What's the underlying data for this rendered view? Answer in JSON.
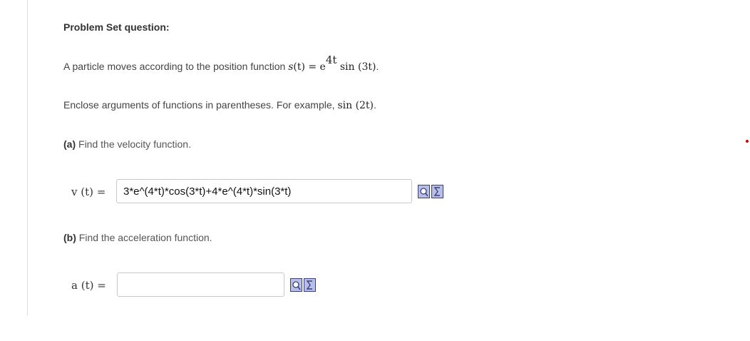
{
  "heading": "Problem Set question:",
  "problem": {
    "intro": "A particle moves according to the position function",
    "func_name": "s",
    "func_arg": "(t) = e",
    "exponent": "4t",
    "func_rest": "sin (3t)",
    "end": "."
  },
  "hint": {
    "text": "Enclose arguments of functions in parentheses. For example,",
    "example": "sin (2t)",
    "end": "."
  },
  "part_a": {
    "letter": "(a)",
    "text": "Find the velocity function.",
    "label": "v (t) =",
    "value": "3*e^(4*t)*cos(3*t)+4*e^(4*t)*sin(3*t)"
  },
  "part_b": {
    "letter": "(b)",
    "text": "Find the acceleration function.",
    "label": "a (t) =",
    "value": ""
  },
  "icons": {
    "preview": "preview-icon",
    "equation_editor": "sigma-icon"
  },
  "colors": {
    "icon_fill": "#b8bfe6",
    "icon_border": "#3a3f7a",
    "marker": "#cc0000"
  }
}
